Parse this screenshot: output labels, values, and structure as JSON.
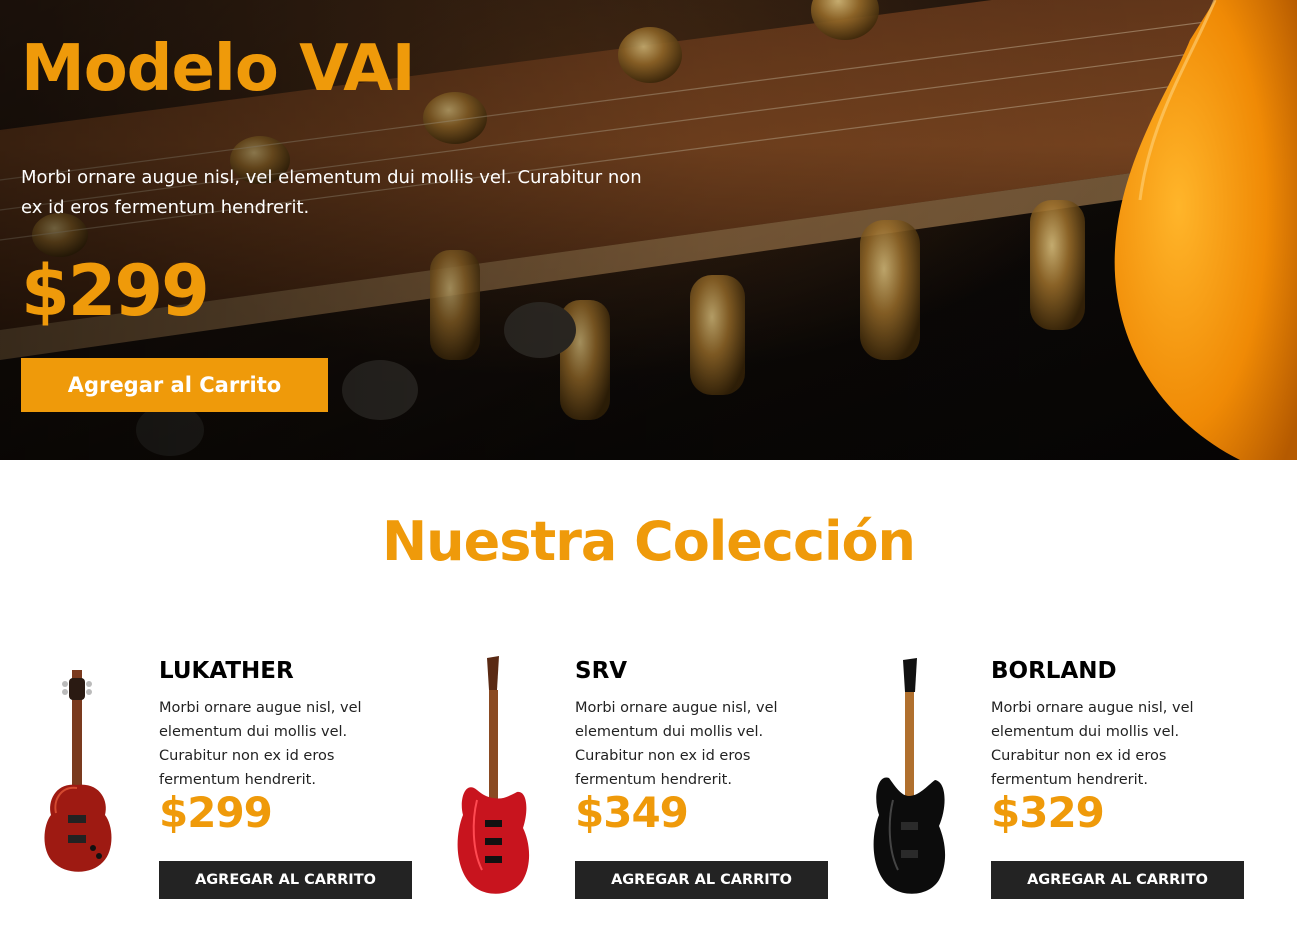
{
  "hero": {
    "title": "Modelo VAI",
    "description": "Morbi ornare augue nisl, vel elementum dui mollis vel. Curabitur non ex id eros fermentum hendrerit.",
    "price": "$299",
    "button_label": "Agregar al Carrito",
    "background_image": "guitar-headstock-tuning-pegs-photo",
    "accent_image": "orange-guitar-body-photo"
  },
  "collection": {
    "title": "Nuestra Colección",
    "products": [
      {
        "name": "LUKATHER",
        "description": "Morbi ornare augue nisl, vel elementum dui mollis vel. Curabitur non ex id eros fermentum hendrerit.",
        "price": "$299",
        "button_label": "AGREGAR AL CARRITO",
        "image": "red-single-cut-guitar-photo"
      },
      {
        "name": "SRV",
        "description": "Morbi ornare augue nisl, vel elementum dui mollis vel. Curabitur non ex id eros fermentum hendrerit.",
        "price": "$349",
        "button_label": "AGREGAR AL CARRITO",
        "image": "red-superstrat-guitar-photo"
      },
      {
        "name": "BORLAND",
        "description": "Morbi ornare augue nisl, vel elementum dui mollis vel. Curabitur non ex id eros fermentum hendrerit.",
        "price": "$329",
        "button_label": "AGREGAR AL CARRITO",
        "image": "black-superstrat-guitar-photo"
      }
    ]
  },
  "colors": {
    "accent": "#ef9a0a",
    "dark_button": "#232323",
    "hero_text": "#ffffff"
  }
}
